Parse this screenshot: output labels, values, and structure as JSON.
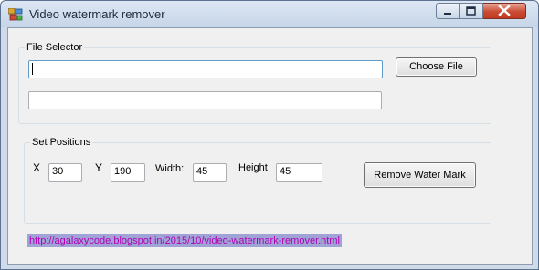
{
  "window": {
    "title": "Video watermark remover"
  },
  "file_selector": {
    "legend": "File Selector",
    "path_value": "",
    "output_value": "",
    "choose_button_label": "Choose File"
  },
  "positions": {
    "legend": "Set Positions",
    "x_label": "X",
    "x_value": "30",
    "y_label": "Y",
    "y_value": "190",
    "width_label": "Width:",
    "width_value": "45",
    "height_label": "Height",
    "height_value": "45",
    "remove_button_label": "Remove Water Mark"
  },
  "footer": {
    "link_text": "http://agalaxycode.blogspot.in/2015/10/video-watermark-remover.html"
  },
  "colors": {
    "link_text": "#b400b4",
    "link_highlight": "#9fa3d6",
    "close_button": "#c94b31"
  }
}
